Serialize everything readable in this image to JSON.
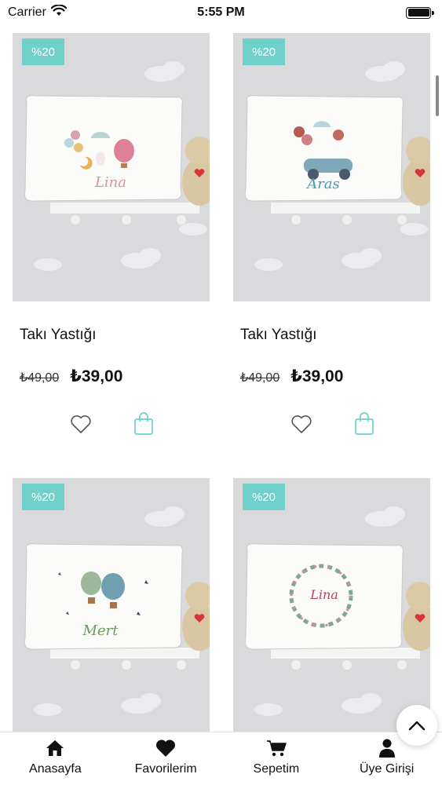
{
  "status_bar": {
    "carrier": "Carrier",
    "time": "5:55 PM"
  },
  "products": [
    {
      "badge": "%20",
      "name": "Takı Yastığı",
      "old_price": "₺49,00",
      "new_price": "₺39,00",
      "pillow_text": "Lina"
    },
    {
      "badge": "%20",
      "name": "Takı Yastığı",
      "old_price": "₺49,00",
      "new_price": "₺39,00",
      "pillow_text": "Aras"
    },
    {
      "badge": "%20",
      "pillow_text": "Mert"
    },
    {
      "badge": "%20",
      "pillow_text": "Lina"
    }
  ],
  "bottom_nav": {
    "items": [
      {
        "label": "Anasayfa",
        "icon": "home-icon"
      },
      {
        "label": "Favorilerim",
        "icon": "heart-icon"
      },
      {
        "label": "Sepetim",
        "icon": "cart-icon"
      },
      {
        "label": "Üye Girişi",
        "icon": "user-icon"
      }
    ]
  },
  "colors": {
    "accent": "#6fd0c9",
    "image_bg": "#d9d9db",
    "text": "#111111"
  }
}
